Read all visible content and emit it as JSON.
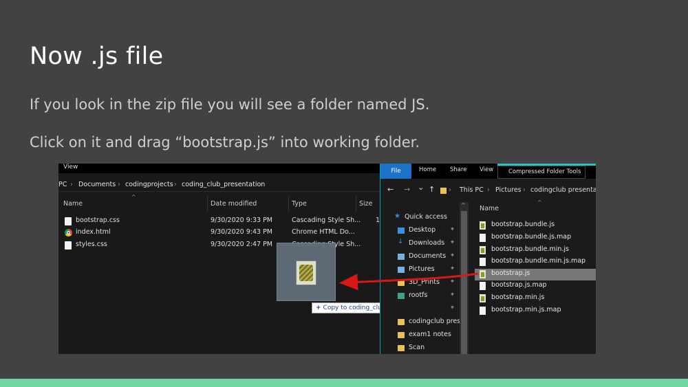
{
  "slide": {
    "title": "Now .js file",
    "paragraph1": "If you look in the zip file you will see a folder named JS.",
    "paragraph2": "Click on it and drag “bootstrap.js” into working folder.",
    "accent_color": "#6ed8a0"
  },
  "left_explorer": {
    "menu": "View",
    "breadcrumb": [
      "PC",
      "Documents",
      "codingprojects",
      "coding_club_presentation"
    ],
    "columns": [
      "Name",
      "Date modified",
      "Type",
      "Size"
    ],
    "size_partial": "1",
    "files": [
      {
        "name": "bootstrap.css",
        "date": "9/30/2020 9:33 PM",
        "type": "Cascading Style Sh...",
        "icon": "document-icon"
      },
      {
        "name": "index.html",
        "date": "9/30/2020 9:43 PM",
        "type": "Chrome HTML Do...",
        "icon": "chrome-icon"
      },
      {
        "name": "styles.css",
        "date": "9/30/2020 2:47 PM",
        "type": "Cascading Style Sh...",
        "icon": "document-icon"
      }
    ],
    "drag_tooltip": "Copy to coding_club_presentation",
    "drag_plus": "+"
  },
  "right_explorer": {
    "ribbon": {
      "file": "File",
      "home": "Home",
      "share": "Share",
      "view": "View",
      "compressed": "Compressed Folder Tools"
    },
    "nav": {
      "back": "←",
      "forward": "→",
      "dropdown": "⌄",
      "up": "↑"
    },
    "breadcrumb": [
      "This PC",
      "Pictures",
      "codingclub presentatio"
    ],
    "sidebar": [
      {
        "label": "Quick access",
        "icon": "star-icon"
      },
      {
        "label": "Desktop",
        "icon": "desktop-icon",
        "pinned": true
      },
      {
        "label": "Downloads",
        "icon": "downloads-icon",
        "pinned": true
      },
      {
        "label": "Documents",
        "icon": "documents-icon",
        "pinned": true
      },
      {
        "label": "Pictures",
        "icon": "pictures-icon",
        "pinned": true
      },
      {
        "label": "3D_Prints",
        "icon": "folder-icon",
        "pinned": true
      },
      {
        "label": "rootfs",
        "icon": "folder-icon",
        "pinned": true
      },
      {
        "label": "",
        "icon": "folder-icon",
        "pinned": true
      },
      {
        "label": "codingclub prese",
        "icon": "folder-icon"
      },
      {
        "label": "exam1 notes",
        "icon": "folder-icon"
      },
      {
        "label": "Scan",
        "icon": "folder-icon"
      }
    ],
    "column_name": "Name",
    "files": [
      {
        "name": "bootstrap.bundle.js",
        "js": true
      },
      {
        "name": "bootstrap.bundle.js.map",
        "js": false
      },
      {
        "name": "bootstrap.bundle.min.js",
        "js": true
      },
      {
        "name": "bootstrap.bundle.min.js.map",
        "js": false
      },
      {
        "name": "bootstrap.js",
        "js": true,
        "selected": true
      },
      {
        "name": "bootstrap.js.map",
        "js": false
      },
      {
        "name": "bootstrap.min.js",
        "js": true
      },
      {
        "name": "bootstrap.min.js.map",
        "js": false
      }
    ],
    "pin_glyph": "⌖"
  }
}
